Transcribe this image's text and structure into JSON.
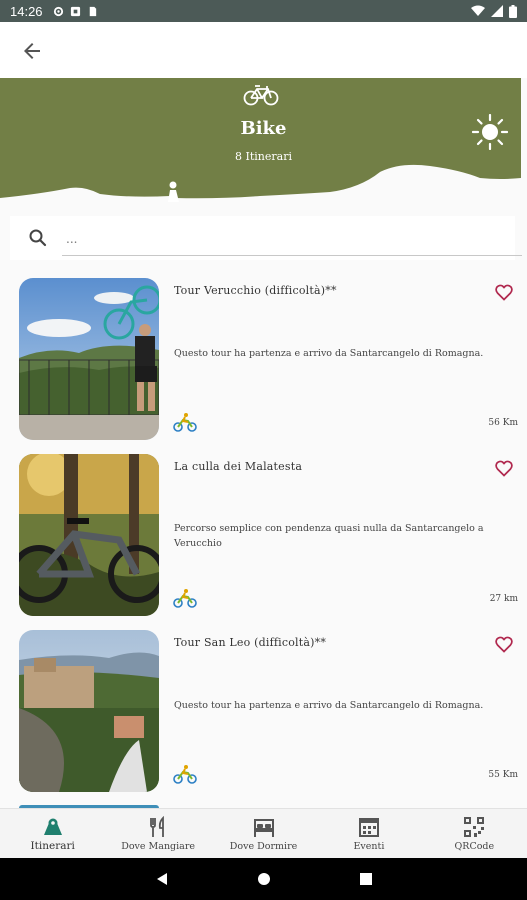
{
  "status_bar": {
    "time": "14:26"
  },
  "header": {
    "category_title": "Bike",
    "count_text": "8 Itinerari"
  },
  "search": {
    "placeholder": "..."
  },
  "itineraries": [
    {
      "title": "Tour Verucchio (difficoltà)**",
      "description": "Questo tour ha partenza e arrivo da Santarcangelo di Romagna.",
      "distance": "56 Km"
    },
    {
      "title": "La culla dei Malatesta",
      "description": "Percorso semplice con pendenza quasi nulla da Santarcangelo a Verucchio",
      "distance": "27 km"
    },
    {
      "title": "Tour San Leo (difficoltà)**",
      "description": "Questo tour ha partenza e arrivo da Santarcangelo di Romagna.",
      "distance": "55 Km"
    }
  ],
  "tabs": [
    {
      "label": "Itinerari",
      "icon": "map-marker-icon"
    },
    {
      "label": "Dove Mangiare",
      "icon": "cutlery-icon"
    },
    {
      "label": "Dove Dormire",
      "icon": "bed-icon"
    },
    {
      "label": "Eventi",
      "icon": "calendar-icon"
    },
    {
      "label": "QRCode",
      "icon": "qrcode-icon"
    }
  ],
  "colors": {
    "header_green": "#727f46",
    "heart": "#b0284e",
    "status_bar": "#4c5a57"
  }
}
